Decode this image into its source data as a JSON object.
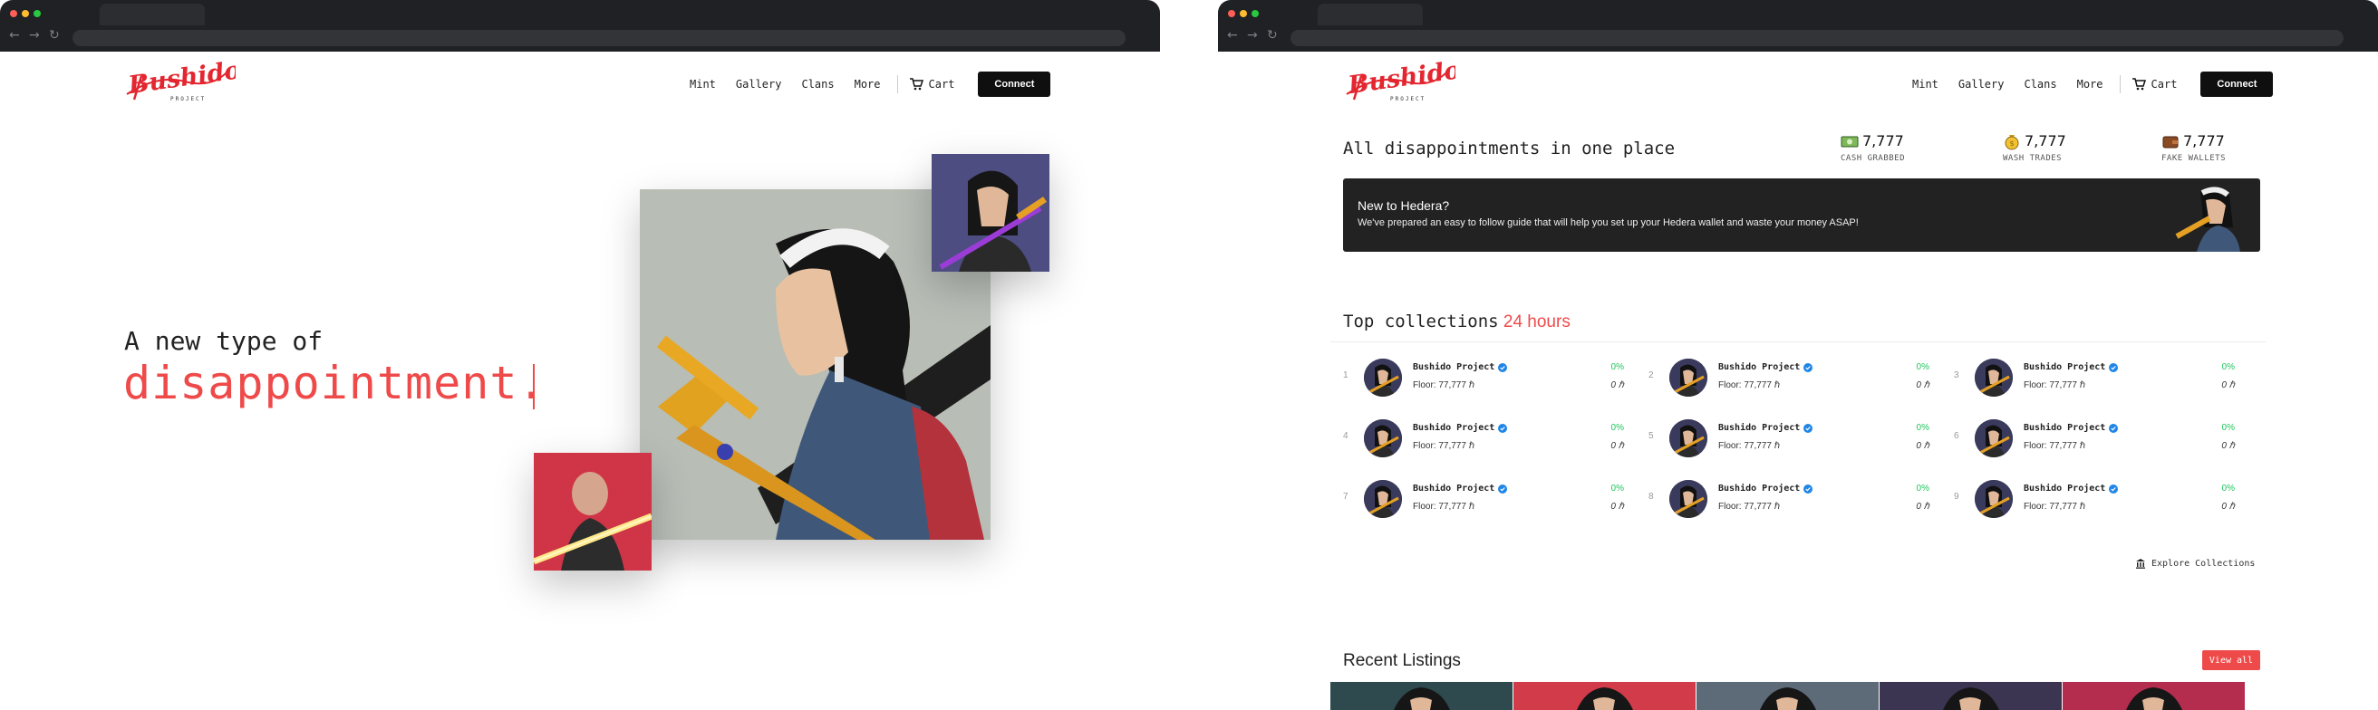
{
  "brand": {
    "logo_text": "Bushido",
    "logo_subtext": "PROJECT",
    "accent": "#ef4a4a",
    "success": "#1fc65c"
  },
  "nav": {
    "items": [
      "Mint",
      "Gallery",
      "Clans",
      "More"
    ],
    "cart": "Cart",
    "connect": "Connect",
    "cart_icon": "cart-icon"
  },
  "home": {
    "headline_line1": "A new type of",
    "headline_line2": "disappointment."
  },
  "dashboard": {
    "title": "All disappointments in one place",
    "stats": [
      {
        "value": "7,777",
        "label": "CASH GRABBED",
        "icon": "cash-icon"
      },
      {
        "value": "7,777",
        "label": "WASH TRADES",
        "icon": "coin-bag-icon"
      },
      {
        "value": "7,777",
        "label": "FAKE WALLETS",
        "icon": "wallet-icon"
      }
    ],
    "banner": {
      "title": "New to Hedera?",
      "subtitle": "We've prepared an easy to follow guide that will help you set up your Hedera wallet and waste your money ASAP!"
    },
    "top_collections": {
      "title": "Top collections",
      "period": "24 hours",
      "items": [
        {
          "rank": "1",
          "name": "Bushido Project",
          "floor": "Floor: 77,777 ℏ",
          "change": "0%",
          "volume": "0 ℏ"
        },
        {
          "rank": "2",
          "name": "Bushido Project",
          "floor": "Floor: 77,777 ℏ",
          "change": "0%",
          "volume": "0 ℏ"
        },
        {
          "rank": "3",
          "name": "Bushido Project",
          "floor": "Floor: 77,777 ℏ",
          "change": "0%",
          "volume": "0 ℏ"
        },
        {
          "rank": "4",
          "name": "Bushido Project",
          "floor": "Floor: 77,777 ℏ",
          "change": "0%",
          "volume": "0 ℏ"
        },
        {
          "rank": "5",
          "name": "Bushido Project",
          "floor": "Floor: 77,777 ℏ",
          "change": "0%",
          "volume": "0 ℏ"
        },
        {
          "rank": "6",
          "name": "Bushido Project",
          "floor": "Floor: 77,777 ℏ",
          "change": "0%",
          "volume": "0 ℏ"
        },
        {
          "rank": "7",
          "name": "Bushido Project",
          "floor": "Floor: 77,777 ℏ",
          "change": "0%",
          "volume": "0 ℏ"
        },
        {
          "rank": "8",
          "name": "Bushido Project",
          "floor": "Floor: 77,777 ℏ",
          "change": "0%",
          "volume": "0 ℏ"
        },
        {
          "rank": "9",
          "name": "Bushido Project",
          "floor": "Floor: 77,777 ℏ",
          "change": "0%",
          "volume": "0 ℏ"
        }
      ],
      "explore": "Explore Collections",
      "explore_icon": "building-icon"
    },
    "recent_listings": {
      "title": "Recent Listings",
      "view_all": "View all",
      "tile_colors": [
        "#2f4a4e",
        "#d23b4a",
        "#5d6a78",
        "#3c3552",
        "#b52d4e"
      ]
    }
  }
}
